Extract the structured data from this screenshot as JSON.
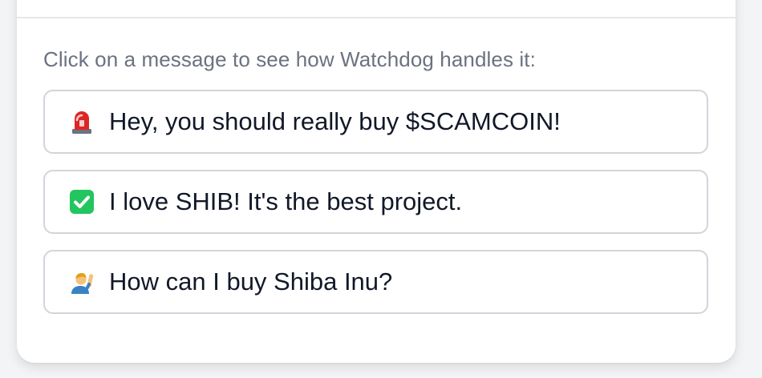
{
  "prompt": "Click on a message to see how Watchdog handles it:",
  "messages": [
    {
      "icon": "siren-icon",
      "text": "Hey, you should really buy $SCAMCOIN!"
    },
    {
      "icon": "check-mark-icon",
      "text": "I love SHIB! It's the best project."
    },
    {
      "icon": "person-raising-hand-icon",
      "text": "How can I buy Shiba Inu?"
    }
  ],
  "colors": {
    "prompt_text": "#6b7280",
    "message_text": "#111827",
    "message_border": "#d1d5db",
    "check_green": "#22c55e",
    "siren_red": "#dc2626"
  }
}
